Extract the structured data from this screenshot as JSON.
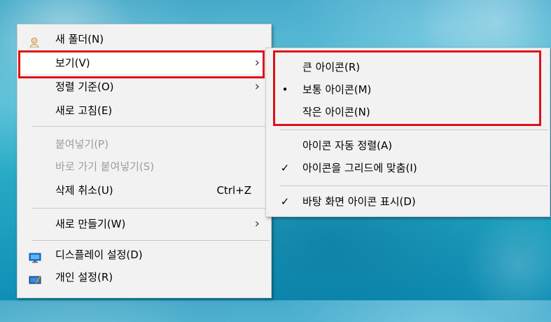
{
  "main_menu": {
    "items": [
      {
        "label": "새 폴더(N)",
        "icon": "user-folder-icon"
      },
      {
        "label": "보기(V)",
        "arrow": "›"
      },
      {
        "label": "정렬 기준(O)",
        "arrow": "›"
      },
      {
        "label": "새로 고침(E)"
      },
      {
        "label": "붙여넣기(P)",
        "disabled": true
      },
      {
        "label": "바로 가기 붙여넣기(S)",
        "disabled": true
      },
      {
        "label": "삭제 취소(U)",
        "shortcut": "Ctrl+Z"
      },
      {
        "label": "새로 만들기(W)",
        "arrow": "›"
      },
      {
        "label": "디스플레이 설정(D)",
        "icon": "display-icon"
      },
      {
        "label": "개인 설정(R)",
        "icon": "personalize-icon"
      }
    ]
  },
  "sub_menu": {
    "items": [
      {
        "label": "큰 아이콘(R)"
      },
      {
        "label": "보통 아이콘(M)",
        "mark": "•"
      },
      {
        "label": "작은 아이콘(N)"
      },
      {
        "label": "아이콘 자동 정렬(A)"
      },
      {
        "label": "아이콘을 그리드에 맞춤(I)",
        "mark": "✓"
      },
      {
        "label": "바탕 화면 아이콘 표시(D)",
        "mark": "✓"
      }
    ]
  },
  "colors": {
    "highlight_border": "#e0101a",
    "menu_bg": "#f2f2f2"
  }
}
